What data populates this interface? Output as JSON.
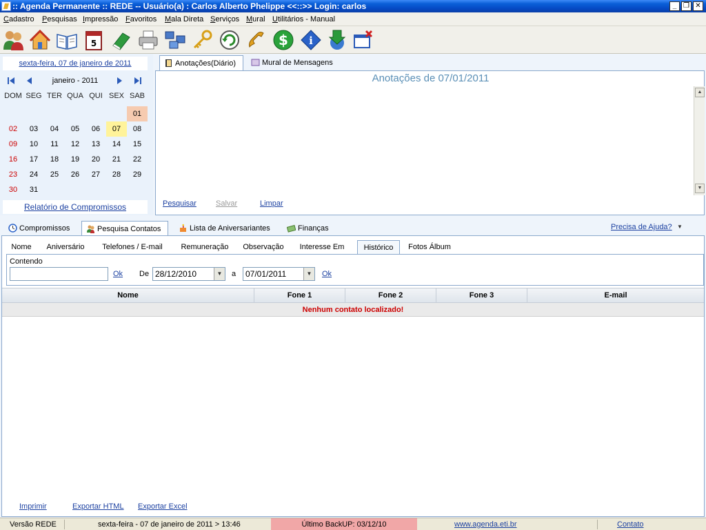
{
  "window": {
    "title": ":: Agenda Permanente :: REDE -- Usuário(a) : Carlos Alberto Phelippe <<::>> Login: carlos",
    "controls": [
      "_",
      "❐",
      "✕"
    ]
  },
  "menu": [
    "Cadastro",
    "Pesquisas",
    "Impressão",
    "Favoritos",
    "Mala Direta",
    "Serviços",
    "Mural",
    "Utilitários - Manual"
  ],
  "toolbar_icons": [
    "users-icon",
    "home-icon",
    "book-icon",
    "calendar-icon",
    "green-book-icon",
    "printer-icon",
    "network-icon",
    "key-icon",
    "refresh-icon",
    "phone-icon",
    "dollar-icon",
    "info-icon",
    "download-icon",
    "close-window-icon"
  ],
  "calendar": {
    "date_link": "sexta-feira, 07 de janeiro de 2011",
    "month_label": "janeiro - 2011",
    "weekdays": [
      "DOM",
      "SEG",
      "TER",
      "QUA",
      "QUI",
      "SEX",
      "SAB"
    ],
    "days": [
      "01",
      "02",
      "03",
      "04",
      "05",
      "06",
      "07",
      "08",
      "09",
      "10",
      "11",
      "12",
      "13",
      "14",
      "15",
      "16",
      "17",
      "18",
      "19",
      "20",
      "21",
      "22",
      "23",
      "24",
      "25",
      "26",
      "27",
      "28",
      "29",
      "30",
      "31"
    ],
    "first_weekday": 6,
    "today": "07",
    "report_link": "Relatório de Compromissos"
  },
  "notes": {
    "tabs": [
      "Anotações(Diário)",
      "Mural de Mensagens"
    ],
    "title": "Anotações de 07/01/2011",
    "actions": {
      "search": "Pesquisar",
      "save": "Salvar",
      "clear": "Limpar"
    }
  },
  "main_tabs": [
    "Compromissos",
    "Pesquisa Contatos",
    "Lista de Aniversariantes",
    "Finanças"
  ],
  "help_link": "Precisa de Ajuda?",
  "sub_tabs": [
    "Nome",
    "Aniversário",
    "Telefones / E-mail",
    "Remuneração",
    "Observação",
    "Interesse Em",
    "Histórico",
    "Fotos Álbum"
  ],
  "filter": {
    "contendo_label": "Contendo",
    "contendo_value": "",
    "ok1": "Ok",
    "de_label": "De",
    "date_from": "28/12/2010",
    "a_label": "a",
    "date_to": "07/01/2011",
    "ok2": "Ok"
  },
  "table": {
    "columns": [
      "Nome",
      "Fone 1",
      "Fone 2",
      "Fone 3",
      "E-mail"
    ],
    "empty_message": "Nenhum contato localizado!"
  },
  "bottom_actions": {
    "print": "Imprimir",
    "export_html": "Exportar HTML",
    "export_excel": "Exportar Excel"
  },
  "status": {
    "version": "Versão REDE",
    "datetime": "sexta-feira - 07 de janeiro de 2011  >  13:46",
    "backup": "Último BackUP: 03/12/10",
    "site": "www.agenda.eti.br",
    "contact": "Contato"
  }
}
